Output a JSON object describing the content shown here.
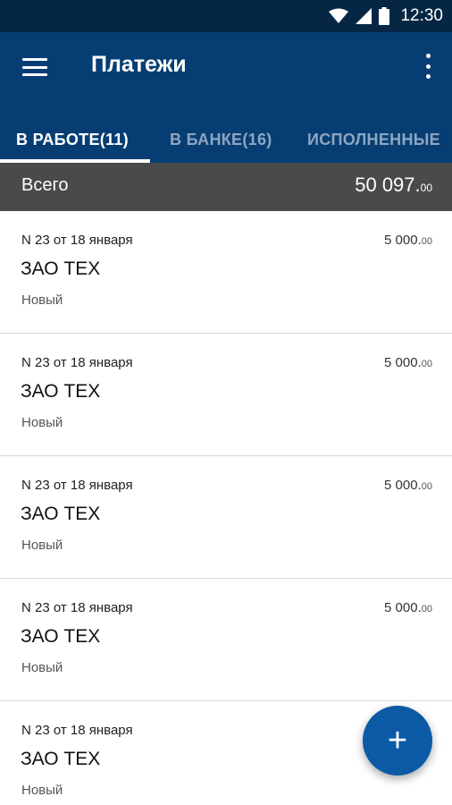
{
  "status_bar": {
    "time": "12:30",
    "icons": [
      "wifi-icon",
      "signal-icon",
      "battery-icon"
    ]
  },
  "app_bar": {
    "title": "Платежи",
    "menu_icon": "menu-icon",
    "more_icon": "more-vert-icon"
  },
  "tabs": [
    {
      "label": "В РАБОТЕ(11)",
      "active": true
    },
    {
      "label": "В БАНКЕ(16)",
      "active": false
    },
    {
      "label": "ИСПОЛНЕННЫЕ",
      "active": false
    }
  ],
  "summary": {
    "label": "Всего",
    "amount_main": "50 097.",
    "amount_cents": "00"
  },
  "payments": [
    {
      "header": "N 23 от 18 января",
      "amount_main": "5 000.",
      "amount_cents": "00",
      "company": "ЗАО ТЕХ",
      "status": "Новый"
    },
    {
      "header": "N 23 от 18 января",
      "amount_main": "5 000.",
      "amount_cents": "00",
      "company": "ЗАО ТЕХ",
      "status": "Новый"
    },
    {
      "header": "N 23 от 18 января",
      "amount_main": "5 000.",
      "amount_cents": "00",
      "company": "ЗАО ТЕХ",
      "status": "Новый"
    },
    {
      "header": "N 23 от 18 января",
      "amount_main": "5 000.",
      "amount_cents": "00",
      "company": "ЗАО ТЕХ",
      "status": "Новый"
    },
    {
      "header": "N 23 от 18 января",
      "amount_main": "",
      "amount_cents": "",
      "company": "ЗАО ТЕХ",
      "status": "Новый"
    }
  ],
  "fab": {
    "icon": "plus-icon",
    "symbol": "+"
  },
  "colors": {
    "status_bar": "#052744",
    "app_bar": "#063e74",
    "summary_bar": "#4a4a4a",
    "fab": "#0c5aa6",
    "inactive_tab": "#8ea6c0"
  }
}
